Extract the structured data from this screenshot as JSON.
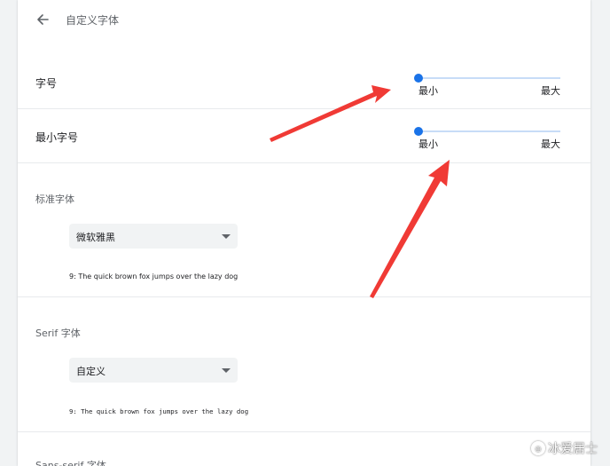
{
  "header": {
    "title": "自定义字体",
    "back_icon": "arrow-left-icon"
  },
  "font_size": {
    "label": "字号",
    "min_label": "最小",
    "max_label": "最大",
    "value_fraction": 0.0
  },
  "min_font_size": {
    "label": "最小字号",
    "min_label": "最小",
    "max_label": "最大",
    "value_fraction": 0.0
  },
  "standard_font": {
    "title": "标准字体",
    "selected": "微软雅黑",
    "sample": "9: The quick brown fox jumps over the lazy dog"
  },
  "serif_font": {
    "title": "Serif 字体",
    "selected": "自定义",
    "sample": "9: The quick brown fox jumps over the lazy dog"
  },
  "sans_serif_font": {
    "title": "Sans-serif 字体"
  },
  "watermark": {
    "text": "冰爱居士"
  },
  "colors": {
    "accent": "#1a73e8",
    "track": "#c7dcf7",
    "annotation_arrow": "#f03a35"
  }
}
